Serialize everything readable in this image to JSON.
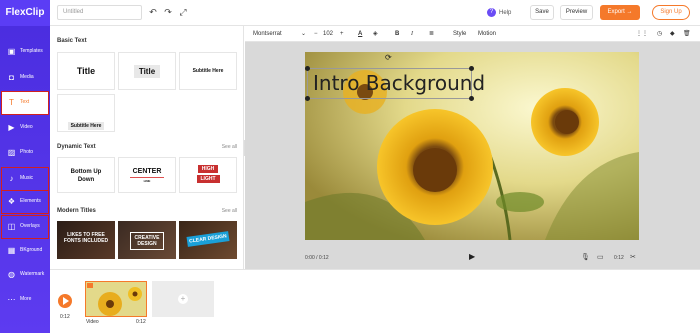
{
  "app": {
    "logo": "FlexClip",
    "title_placeholder": "Untitled"
  },
  "topbar": {
    "help_label": "Help",
    "save_label": "Save",
    "preview_label": "Preview",
    "export_label": "Export →",
    "signup_label": "Sign Up"
  },
  "nav": {
    "items": [
      {
        "label": "Templates",
        "icon": "templates-icon"
      },
      {
        "label": "Media",
        "icon": "media-icon"
      },
      {
        "label": "Text",
        "icon": "text-icon"
      },
      {
        "label": "Video",
        "icon": "video-icon"
      },
      {
        "label": "Photo",
        "icon": "photo-icon"
      },
      {
        "label": "Music",
        "icon": "music-icon"
      },
      {
        "label": "Elements",
        "icon": "elements-icon"
      },
      {
        "label": "Overlays",
        "icon": "overlays-icon"
      },
      {
        "label": "BKground",
        "icon": "background-icon"
      },
      {
        "label": "Watermark",
        "icon": "watermark-icon"
      },
      {
        "label": "More",
        "icon": "more-icon"
      }
    ]
  },
  "panel": {
    "basic_text_title": "Basic Text",
    "basic_cards": [
      "Title",
      "Title",
      "Subtitle Here",
      "Subtitle Here"
    ],
    "dynamic_title": "Dynamic Text",
    "dynamic_see_all": "See all",
    "dynamic_cards": [
      "Bottom Up Down",
      "CENTER",
      "LINE",
      "HIGH",
      "LIGHT"
    ],
    "modern_title": "Modern Titles",
    "modern_see_all": "See all",
    "modern_cards": [
      "LIKES TO FREE FONTS INCLUDED",
      "CREATIVE DESIGN",
      "CLEAR DESIGN"
    ]
  },
  "toolbar": {
    "font": "Montserrat",
    "size": "102",
    "style_label": "Style",
    "motion_label": "Motion"
  },
  "stage": {
    "overlay_text": "Intro Background",
    "time": "0:00 / 0:12",
    "duration": "0:12"
  },
  "timeline": {
    "play_time": "0:12",
    "clip_label": "Video",
    "clip_duration": "0:12"
  },
  "colors": {
    "brand": "#5b3df5",
    "accent": "#f5792a",
    "highlight": "#d02020"
  }
}
